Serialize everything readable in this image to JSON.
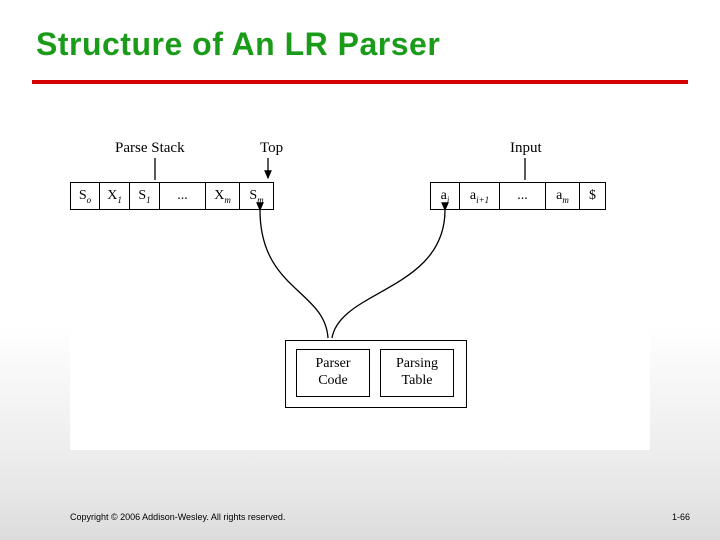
{
  "title": "Structure of An LR Parser",
  "labels": {
    "parse_stack": "Parse Stack",
    "top": "Top",
    "input": "Input"
  },
  "stack_cells": [
    {
      "main": "S",
      "sub": "o"
    },
    {
      "main": "X",
      "sub": "1"
    },
    {
      "main": "S",
      "sub": "1"
    },
    {
      "main": "...",
      "sub": ""
    },
    {
      "main": "X",
      "sub": "m"
    },
    {
      "main": "S",
      "sub": "m"
    }
  ],
  "input_cells": [
    {
      "main": "a",
      "sub": "i"
    },
    {
      "main": "a",
      "sub": "i+1"
    },
    {
      "main": "...",
      "sub": ""
    },
    {
      "main": "a",
      "sub": "m"
    },
    {
      "main": "$",
      "sub": ""
    }
  ],
  "boxes": {
    "parser_code": "Parser\nCode",
    "parsing_table": "Parsing\nTable"
  },
  "footer": {
    "copyright": "Copyright © 2006 Addison-Wesley. All rights reserved.",
    "page": "1-66"
  }
}
